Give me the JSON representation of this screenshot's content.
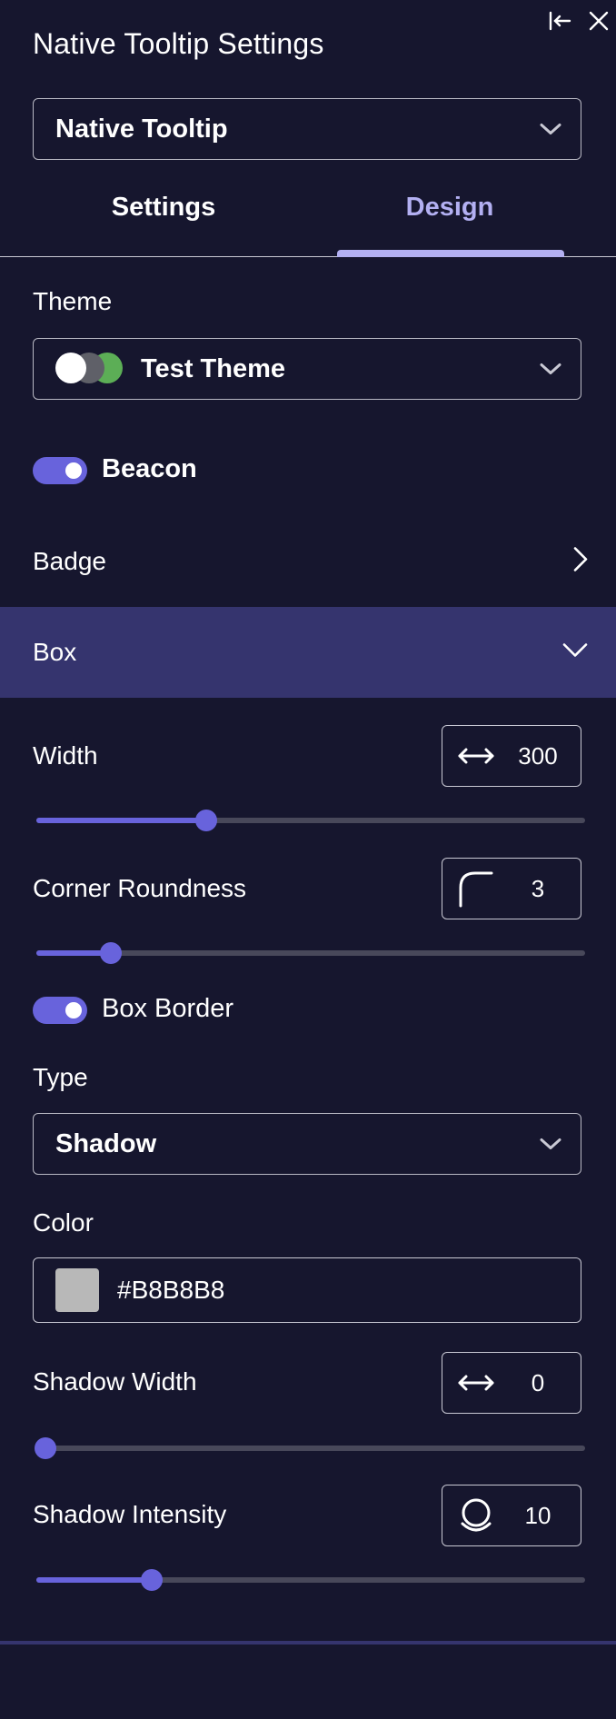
{
  "title": "Native Tooltip Settings",
  "window": {
    "collapse_icon": "collapse-left-icon",
    "close_icon": "close-icon"
  },
  "component_select": {
    "value": "Native Tooltip"
  },
  "tabs": [
    {
      "label": "Settings",
      "active": false
    },
    {
      "label": "Design",
      "active": true
    }
  ],
  "theme": {
    "label": "Theme",
    "value": "Test Theme",
    "swatch_colors": [
      "#ffffff",
      "#5f6068",
      "#5cae56"
    ]
  },
  "beacon": {
    "label": "Beacon",
    "enabled": true
  },
  "badge": {
    "label": "Badge",
    "expanded": false
  },
  "box": {
    "label": "Box",
    "expanded": true,
    "width": {
      "label": "Width",
      "value": "300",
      "fraction": 0.31
    },
    "corner_roundness": {
      "label": "Corner Roundness",
      "value": "3",
      "fraction": 0.135
    },
    "box_border": {
      "label": "Box Border",
      "enabled": true
    },
    "type": {
      "label": "Type",
      "value": "Shadow"
    },
    "color": {
      "label": "Color",
      "value": "#B8B8B8",
      "swatch": "#b8b8b8"
    },
    "shadow_width": {
      "label": "Shadow Width",
      "value": "0",
      "fraction": 0.0
    },
    "shadow_intensity": {
      "label": "Shadow Intensity",
      "value": "10",
      "fraction": 0.21
    }
  },
  "colors": {
    "accent": "#6863dc",
    "tab_active": "#b3b0f2",
    "background": "#16162e",
    "section_active": "#35346e"
  }
}
